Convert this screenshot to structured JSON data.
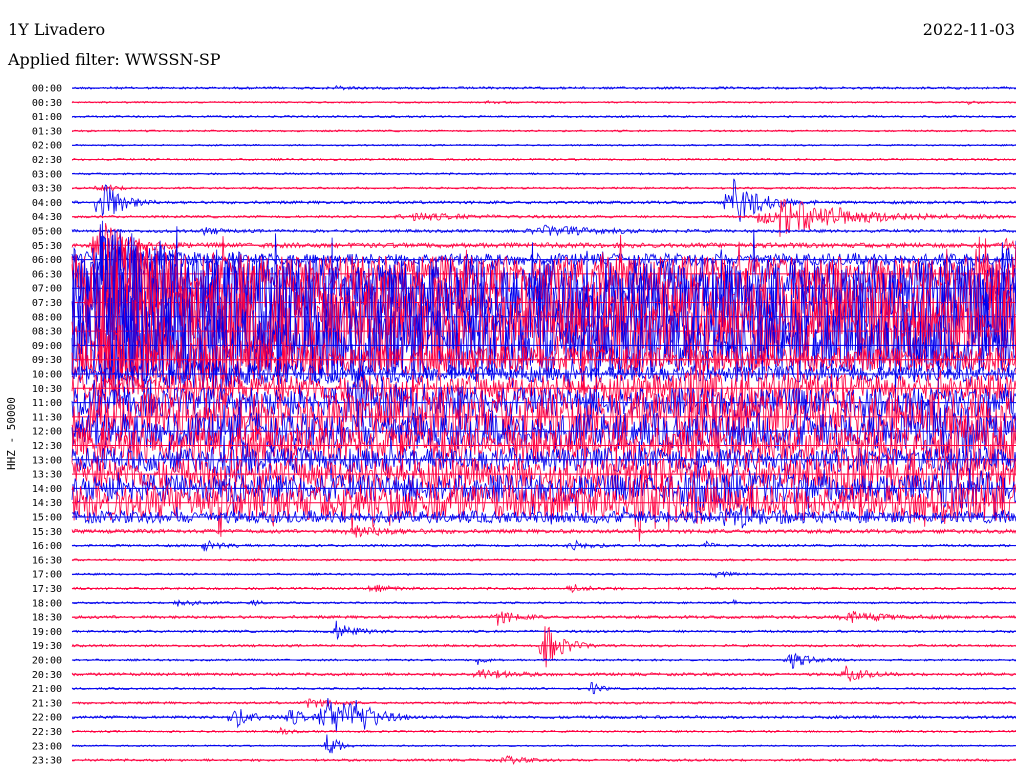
{
  "chart_data": {
    "type": "line",
    "title": "1Y Livadero",
    "date": "2022-11-03",
    "subtitle": "Applied filter: WWSSN-SP",
    "ylabel": "HHZ - 50000",
    "colors": {
      "blue": "#0000ee",
      "red": "#ff0040"
    },
    "rows": [
      {
        "label": "00:00",
        "color": "blue",
        "noise": 1.2,
        "events": [
          [
            28,
            2,
            1.5
          ]
        ]
      },
      {
        "label": "00:30",
        "color": "red",
        "noise": 0.8,
        "events": [
          [
            44,
            2,
            1.2
          ],
          [
            95,
            1,
            1.5
          ]
        ]
      },
      {
        "label": "01:00",
        "color": "blue",
        "noise": 1.0,
        "events": []
      },
      {
        "label": "01:30",
        "color": "red",
        "noise": 0.9,
        "events": []
      },
      {
        "label": "02:00",
        "color": "blue",
        "noise": 0.8,
        "events": []
      },
      {
        "label": "02:30",
        "color": "red",
        "noise": 1.0,
        "events": []
      },
      {
        "label": "03:00",
        "color": "blue",
        "noise": 1.0,
        "events": [
          [
            103,
            4,
            18
          ]
        ]
      },
      {
        "label": "03:30",
        "color": "red",
        "noise": 1.0,
        "events": [
          [
            3,
            2,
            4
          ]
        ]
      },
      {
        "label": "04:00",
        "color": "blue",
        "noise": 1.5,
        "events": [
          [
            3,
            2,
            30
          ],
          [
            70,
            3,
            25
          ]
        ]
      },
      {
        "label": "04:30",
        "color": "red",
        "noise": 1.2,
        "events": [
          [
            36,
            6,
            4
          ],
          [
            75,
            8,
            20
          ]
        ]
      },
      {
        "label": "05:00",
        "color": "blue",
        "noise": 1.5,
        "events": [
          [
            14,
            2,
            3
          ],
          [
            50,
            6,
            5
          ]
        ]
      },
      {
        "label": "05:30",
        "color": "red",
        "noise": 2.5,
        "events": [
          [
            3,
            3,
            25
          ],
          [
            100,
            4,
            15
          ]
        ]
      },
      {
        "label": "06:00",
        "color": "blue",
        "noise": 6,
        "events": [
          [
            3,
            5,
            20
          ],
          [
            100,
            5,
            20
          ]
        ]
      },
      {
        "label": "06:30",
        "color": "red",
        "noise": 18,
        "events": [
          [
            3,
            6,
            45
          ],
          [
            100,
            15,
            30
          ]
        ]
      },
      {
        "label": "07:00",
        "color": "blue",
        "noise": 30,
        "events": [
          [
            3,
            10,
            40
          ]
        ]
      },
      {
        "label": "07:30",
        "color": "red",
        "noise": 35,
        "events": [
          [
            3,
            10,
            50
          ],
          [
            100,
            10,
            40
          ]
        ]
      },
      {
        "label": "08:00",
        "color": "blue",
        "noise": 45,
        "events": [
          [
            3,
            15,
            45
          ]
        ]
      },
      {
        "label": "08:30",
        "color": "red",
        "noise": 35,
        "events": [
          [
            3,
            15,
            40
          ],
          [
            100,
            10,
            35
          ]
        ]
      },
      {
        "label": "09:00",
        "color": "blue",
        "noise": 30,
        "events": [
          [
            3,
            20,
            35
          ]
        ]
      },
      {
        "label": "09:30",
        "color": "red",
        "noise": 12,
        "events": [
          [
            3,
            20,
            20
          ]
        ]
      },
      {
        "label": "10:00",
        "color": "blue",
        "noise": 8,
        "events": [
          [
            10,
            10,
            12
          ]
        ]
      },
      {
        "label": "10:30",
        "color": "red",
        "noise": 14,
        "events": [
          [
            65,
            6,
            20
          ]
        ]
      },
      {
        "label": "11:00",
        "color": "blue",
        "noise": 15,
        "events": [
          [
            30,
            6,
            20
          ]
        ]
      },
      {
        "label": "11:30",
        "color": "red",
        "noise": 25,
        "events": []
      },
      {
        "label": "12:00",
        "color": "blue",
        "noise": 18,
        "events": [
          [
            90,
            4,
            20
          ]
        ]
      },
      {
        "label": "12:30",
        "color": "red",
        "noise": 18,
        "events": [
          [
            93,
            5,
            25
          ]
        ]
      },
      {
        "label": "13:00",
        "color": "blue",
        "noise": 12,
        "events": [
          [
            16,
            4,
            15
          ]
        ]
      },
      {
        "label": "13:30",
        "color": "red",
        "noise": 16,
        "events": [
          [
            82,
            5,
            12
          ]
        ]
      },
      {
        "label": "14:00",
        "color": "blue",
        "noise": 14,
        "events": [
          [
            66,
            6,
            15
          ],
          [
            92,
            4,
            15
          ]
        ]
      },
      {
        "label": "14:30",
        "color": "red",
        "noise": 18,
        "events": [
          [
            60,
            4,
            25
          ],
          [
            90,
            3,
            10
          ]
        ]
      },
      {
        "label": "15:00",
        "color": "blue",
        "noise": 6,
        "events": [
          [
            70,
            3,
            10
          ]
        ]
      },
      {
        "label": "15:30",
        "color": "red",
        "noise": 2,
        "events": [
          [
            30,
            4,
            5
          ]
        ]
      },
      {
        "label": "16:00",
        "color": "blue",
        "noise": 1.2,
        "events": [
          [
            14,
            2,
            5
          ],
          [
            53,
            2,
            5
          ],
          [
            67,
            1,
            4
          ]
        ]
      },
      {
        "label": "16:30",
        "color": "red",
        "noise": 1.0,
        "events": []
      },
      {
        "label": "17:00",
        "color": "blue",
        "noise": 1.0,
        "events": [
          [
            68,
            2,
            3
          ]
        ]
      },
      {
        "label": "17:30",
        "color": "red",
        "noise": 1.2,
        "events": [
          [
            32,
            2,
            4
          ],
          [
            53,
            2,
            4
          ]
        ]
      },
      {
        "label": "18:00",
        "color": "blue",
        "noise": 1.0,
        "events": [
          [
            11,
            2,
            5
          ],
          [
            19,
            1,
            3
          ],
          [
            70,
            1,
            3
          ]
        ]
      },
      {
        "label": "18:30",
        "color": "red",
        "noise": 1.5,
        "events": [
          [
            45,
            2,
            8
          ],
          [
            82,
            4,
            6
          ]
        ]
      },
      {
        "label": "19:00",
        "color": "blue",
        "noise": 1.2,
        "events": [
          [
            28,
            2,
            10
          ]
        ]
      },
      {
        "label": "19:30",
        "color": "red",
        "noise": 1.2,
        "events": [
          [
            50,
            2,
            25
          ]
        ]
      },
      {
        "label": "20:00",
        "color": "blue",
        "noise": 1.0,
        "events": [
          [
            43,
            1,
            4
          ],
          [
            76,
            2,
            10
          ]
        ]
      },
      {
        "label": "20:30",
        "color": "red",
        "noise": 1.5,
        "events": [
          [
            43,
            3,
            6
          ],
          [
            82,
            2,
            8
          ]
        ]
      },
      {
        "label": "21:00",
        "color": "blue",
        "noise": 1.0,
        "events": [
          [
            55,
            1,
            8
          ]
        ]
      },
      {
        "label": "21:30",
        "color": "red",
        "noise": 1.2,
        "events": [
          [
            25,
            2,
            6
          ]
        ]
      },
      {
        "label": "22:00",
        "color": "blue",
        "noise": 1.5,
        "events": [
          [
            17,
            2,
            12
          ],
          [
            23,
            2,
            8
          ],
          [
            27,
            3,
            25
          ],
          [
            30,
            2,
            15
          ]
        ]
      },
      {
        "label": "22:30",
        "color": "red",
        "noise": 1.0,
        "events": [
          [
            22,
            1,
            4
          ]
        ]
      },
      {
        "label": "23:00",
        "color": "blue",
        "noise": 0.8,
        "events": [
          [
            27,
            1,
            20
          ]
        ]
      },
      {
        "label": "23:30",
        "color": "red",
        "noise": 1.2,
        "events": [
          [
            46,
            2,
            4
          ]
        ]
      }
    ]
  }
}
